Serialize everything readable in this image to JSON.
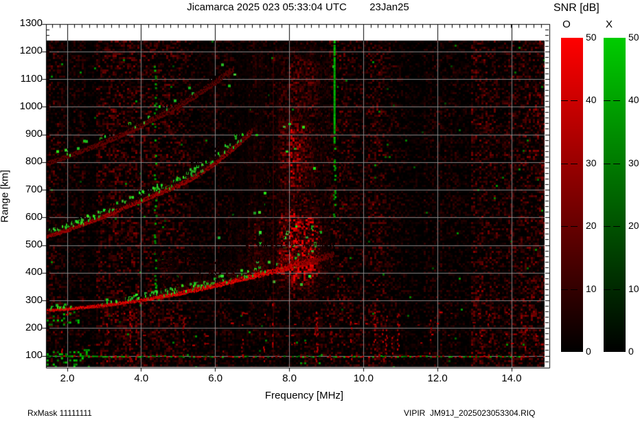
{
  "page": {
    "title": "Jicamarca 2025 023 05:33:04 UTC        23Jan25",
    "footer_left": "RxMask 11111111",
    "footer_right": "VIPIR  JM91J_2025023053304.RIQ"
  },
  "chart_data": {
    "type": "heatmap",
    "subtype": "HF-ionogram",
    "station": "Jicamarca",
    "title": "Jicamarca 2025 023 05:33:04 UTC",
    "date_label": "23Jan25",
    "xlabel": "Frequency [MHz]",
    "ylabel": "Range [km]",
    "x_tick_values": [
      2,
      4,
      6,
      8,
      10,
      12,
      14
    ],
    "x_tick_labels": [
      "2.0",
      "4.0",
      "6.0",
      "8.0",
      "10.0",
      "12.0",
      "14.0"
    ],
    "y_tick_values": [
      1300,
      1200,
      1100,
      1000,
      900,
      800,
      700,
      600,
      500,
      400,
      300,
      200,
      100
    ],
    "y_tick_labels": [
      "1300",
      "1200",
      "1100",
      "1000",
      "900",
      "800",
      "700",
      "600",
      "500",
      "400",
      "300",
      "200",
      "100"
    ],
    "x_range_mhz": [
      1.44,
      14.89
    ],
    "y_range_km": [
      63,
      1300
    ],
    "grid": true,
    "grid_color": "#969696",
    "background_color": "#000000",
    "colorbar": {
      "title": "SNR [dB]",
      "min": 0,
      "max": 50,
      "tick_values": [
        50,
        40,
        30,
        20,
        10,
        0
      ],
      "tick_labels": [
        "50",
        "40",
        "30",
        "20",
        "10",
        "0"
      ],
      "bars": [
        {
          "label": "O",
          "polarization": "ordinary",
          "top_color": "#ff0000",
          "bottom_color": "#000000"
        },
        {
          "label": "X",
          "polarization": "extraordinary",
          "top_color": "#00cc00",
          "bottom_color": "#000000"
        }
      ]
    },
    "echo_traces": [
      {
        "name": "F-region-1st-hop",
        "points_mhz_km": [
          [
            1.44,
            263
          ],
          [
            2,
            268
          ],
          [
            3,
            281
          ],
          [
            4,
            299
          ],
          [
            5,
            321
          ],
          [
            6,
            350
          ],
          [
            7,
            381
          ],
          [
            8,
            413
          ],
          [
            8.7,
            438
          ],
          [
            9.2,
            458
          ]
        ],
        "core_width_km": [
          [
            1.44,
            7
          ],
          [
            4,
            10
          ],
          [
            6,
            14
          ],
          [
            8,
            20
          ],
          [
            9.2,
            24
          ]
        ],
        "brightness": [
          [
            1.44,
            1.0
          ],
          [
            7.5,
            1.0
          ],
          [
            8.3,
            0.75
          ],
          [
            8.8,
            0.4
          ],
          [
            9.2,
            0.15
          ]
        ],
        "spread_above_km": [
          [
            1.44,
            10
          ],
          [
            4,
            18
          ],
          [
            5,
            35
          ],
          [
            6,
            90
          ],
          [
            7,
            160
          ],
          [
            8,
            170
          ],
          [
            9.2,
            110
          ]
        ],
        "green_density": [
          [
            1.44,
            0.5
          ],
          [
            1.9,
            0.3
          ],
          [
            2.6,
            0.12
          ],
          [
            3.5,
            0.3
          ],
          [
            5,
            0.35
          ],
          [
            6.5,
            0.4
          ],
          [
            7.3,
            0.3
          ],
          [
            7.6,
            0.08
          ],
          [
            9.2,
            0.02
          ]
        ]
      },
      {
        "name": "2nd-hop",
        "points_mhz_km": [
          [
            1.44,
            528
          ],
          [
            2,
            550
          ],
          [
            3,
            600
          ],
          [
            3.7,
            640
          ],
          [
            4.3,
            672
          ],
          [
            5,
            710
          ],
          [
            5.5,
            745
          ],
          [
            6,
            790
          ],
          [
            6.6,
            855
          ],
          [
            7,
            905
          ]
        ],
        "core_width_km": [
          [
            1.44,
            10
          ],
          [
            7,
            20
          ]
        ],
        "brightness": [
          [
            1.44,
            0.55
          ],
          [
            3,
            0.6
          ],
          [
            5,
            0.55
          ],
          [
            6.5,
            0.45
          ],
          [
            7,
            0.3
          ]
        ],
        "spread_above_km": [
          [
            1.44,
            30
          ],
          [
            3,
            45
          ],
          [
            5,
            60
          ],
          [
            7,
            80
          ]
        ],
        "green_density": [
          [
            1.44,
            0.4
          ],
          [
            3,
            0.35
          ],
          [
            5,
            0.3
          ],
          [
            6.5,
            0.22
          ],
          [
            7,
            0.08
          ]
        ]
      },
      {
        "name": "3rd-hop",
        "points_mhz_km": [
          [
            1.44,
            790
          ],
          [
            2,
            815
          ],
          [
            3,
            865
          ],
          [
            4,
            925
          ],
          [
            5,
            995
          ],
          [
            5.5,
            1035
          ],
          [
            6,
            1080
          ],
          [
            6.5,
            1130
          ]
        ],
        "core_width_km": [
          [
            1.44,
            14
          ],
          [
            6.5,
            22
          ]
        ],
        "brightness": [
          [
            1.44,
            0.18
          ],
          [
            3,
            0.25
          ],
          [
            5,
            0.22
          ],
          [
            6.5,
            0.12
          ]
        ],
        "spread_above_km": [
          [
            1.44,
            30
          ],
          [
            6.5,
            50
          ]
        ],
        "green_density": [
          [
            1.44,
            0.05
          ],
          [
            3,
            0.06
          ],
          [
            6.5,
            0.03
          ]
        ]
      }
    ],
    "spread_f_regions": [
      {
        "f0": 5.6,
        "f1": 9.6,
        "r0": 260,
        "r1": 1240,
        "amp": 0.3,
        "green": 0.0015
      },
      {
        "f0": 6.0,
        "f1": 9.2,
        "r0": 330,
        "r1": 660,
        "amp": 0.85,
        "green": 0.01
      },
      {
        "f0": 6.2,
        "f1": 8.8,
        "r0": 660,
        "r1": 1000,
        "amp": 0.45,
        "green": 0.004
      },
      {
        "f0": 5.4,
        "f1": 7.8,
        "r0": 1000,
        "r1": 1240,
        "amp": 0.4,
        "green": 0.002
      },
      {
        "f0": 4.0,
        "f1": 5.8,
        "r0": 330,
        "r1": 520,
        "amp": 0.25,
        "green": 0.004
      }
    ],
    "interference": [
      {
        "type": "green-solid",
        "f": 9.21,
        "r0": 870,
        "r1": 1240
      },
      {
        "type": "green-speckle",
        "f": 9.21,
        "r0": 580,
        "r1": 870,
        "density": 0.35
      },
      {
        "type": "green-speckle",
        "f": 4.38,
        "r0": 330,
        "r1": 1150,
        "density": 0.3
      },
      {
        "type": "red-column",
        "f": 7.55,
        "r0": 100,
        "r1": 1200,
        "alpha": 0.35
      }
    ],
    "clutter": {
      "rows_km": [
        256,
        219,
        177,
        145
      ],
      "row_density": 0.1,
      "baseline_km": 100,
      "baseline_density": 0.72,
      "column_count": 22,
      "column_r0": 85,
      "column_r1": 265,
      "corner_green": [
        {
          "f0": 1.44,
          "f1": 2.6,
          "r0": 60,
          "r1": 125,
          "density": 0.22
        },
        {
          "f0": 1.44,
          "f1": 2.3,
          "r0": 210,
          "r1": 262,
          "density": 0.16
        }
      ]
    },
    "noise": {
      "seed": 20250123,
      "base_red": 0.5,
      "green_speckle": 0.003
    }
  }
}
